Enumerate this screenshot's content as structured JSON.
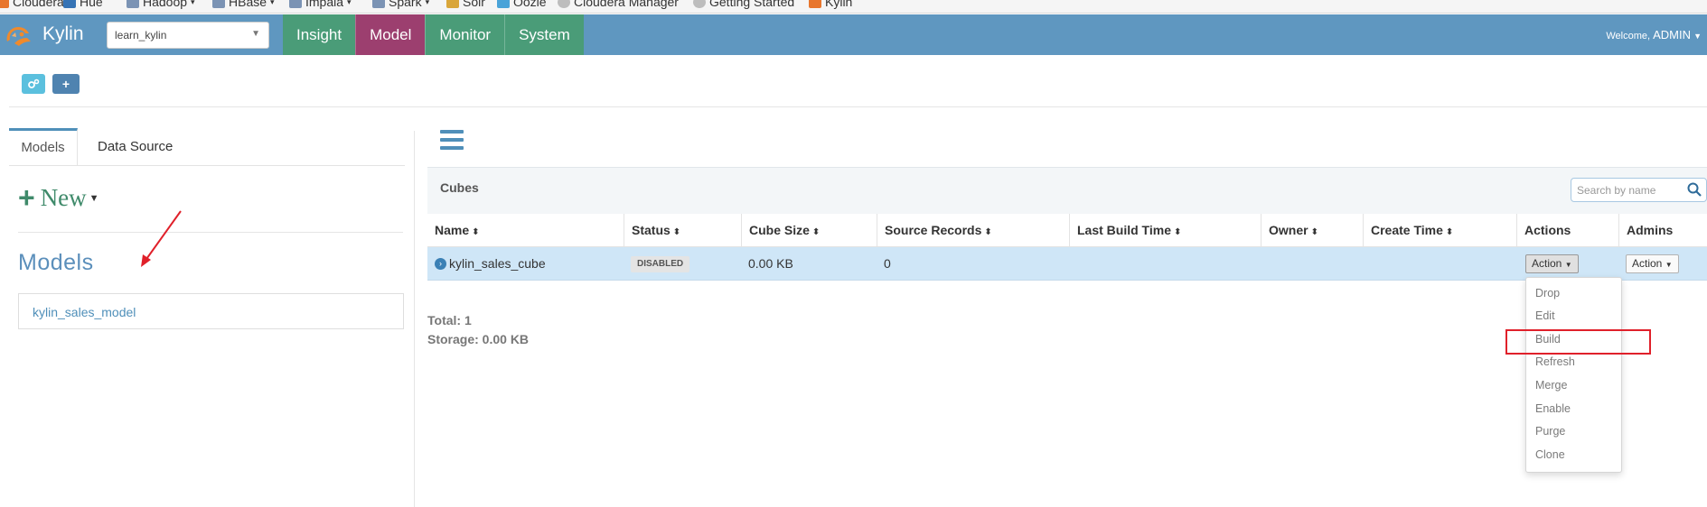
{
  "bookmarks": [
    {
      "label": "Cloudera",
      "color": "#e8762d",
      "caret": false
    },
    {
      "label": "Hue",
      "color": "#3573b5",
      "caret": false
    },
    {
      "label": "Hadoop",
      "color": "#7b93b4",
      "caret": true
    },
    {
      "label": "HBase",
      "color": "#7b93b4",
      "caret": true
    },
    {
      "label": "Impala",
      "color": "#7b93b4",
      "caret": true
    },
    {
      "label": "Spark",
      "color": "#7b93b4",
      "caret": true
    },
    {
      "label": "Solr",
      "color": "#d9a63a",
      "caret": false
    },
    {
      "label": "Oozie",
      "color": "#4aa3d8",
      "caret": false
    },
    {
      "label": "Cloudera Manager",
      "color": "#bdbdbd",
      "caret": false
    },
    {
      "label": "Getting Started",
      "color": "#bdbdbd",
      "caret": false
    },
    {
      "label": "Kylin",
      "color": "#e8762d",
      "caret": false
    }
  ],
  "navbar": {
    "brand": "Kylin",
    "project": "learn_kylin",
    "tabs": [
      "Insight",
      "Model",
      "Monitor",
      "System"
    ],
    "active_tab": "Model",
    "welcome": "Welcome,",
    "user": "ADMIN"
  },
  "left": {
    "tabs": [
      "Models",
      "Data Source"
    ],
    "new_label": "New",
    "models_title": "Models",
    "models": [
      "kylin_sales_model"
    ]
  },
  "cubes": {
    "panel_title": "Cubes",
    "search_placeholder": "Search by name",
    "headers": [
      "Name",
      "Status",
      "Cube Size",
      "Source Records",
      "Last Build Time",
      "Owner",
      "Create Time",
      "Actions",
      "Admins"
    ],
    "rows": [
      {
        "name": "kylin_sales_cube",
        "status": "DISABLED",
        "cube_size": "0.00 KB",
        "source_records": "0",
        "last_build_time": "",
        "owner": "",
        "create_time": "",
        "action_label": "Action",
        "admin_label": "Action"
      }
    ],
    "total": "Total: 1",
    "storage": "Storage: 0.00 KB"
  },
  "action_menu": [
    "Drop",
    "Edit",
    "Build",
    "Refresh",
    "Merge",
    "Enable",
    "Purge",
    "Clone"
  ],
  "highlighted_action": "Build",
  "colors": {
    "navbar": "#5f97c0",
    "tab": "#4a9c78",
    "tab_active": "#9c3f6f",
    "selected_row": "#cfe6f7",
    "annotation": "#e0202a"
  }
}
